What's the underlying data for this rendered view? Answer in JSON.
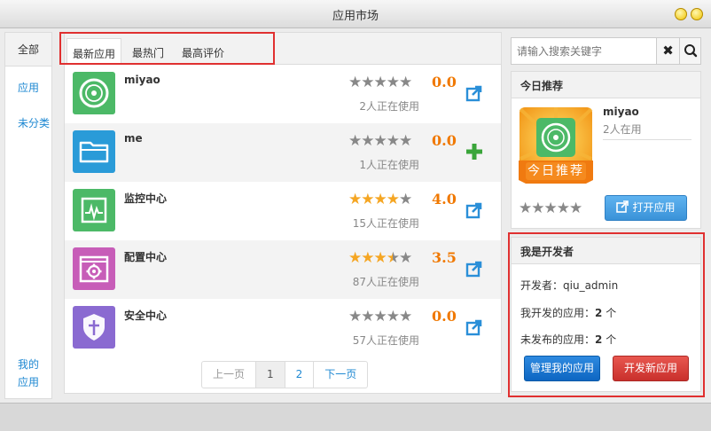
{
  "window": {
    "title": "应用市场"
  },
  "leftnav": {
    "all": "全部",
    "apps": "应用",
    "uncategorized": "未分类",
    "mine": "我的应用"
  },
  "tabs": [
    "最新应用",
    "最热门",
    "最高评价"
  ],
  "apps": [
    {
      "name": "miyao",
      "score": "0.0",
      "rating": 0,
      "users": "2人正在使用",
      "color": "#4cb967",
      "icon": "disc-icon",
      "action": "open"
    },
    {
      "name": "me",
      "score": "0.0",
      "rating": 0,
      "users": "1人正在使用",
      "color": "#2a9bd8",
      "icon": "folder-icon",
      "action": "add"
    },
    {
      "name": "监控中心",
      "score": "4.0",
      "rating": 4,
      "users": "15人正在使用",
      "color": "#4cb967",
      "icon": "monitor-icon",
      "action": "open"
    },
    {
      "name": "配置中心",
      "score": "3.5",
      "rating": 3.5,
      "users": "87人正在使用",
      "color": "#c75db8",
      "icon": "config-icon",
      "action": "open"
    },
    {
      "name": "安全中心",
      "score": "0.0",
      "rating": 0,
      "users": "57人正在使用",
      "color": "#8a6ad1",
      "icon": "shield-icon",
      "action": "open"
    }
  ],
  "pager": {
    "prev": "上一页",
    "pages": [
      "1",
      "2"
    ],
    "next": "下一页"
  },
  "search": {
    "placeholder": "请输入搜索关键字"
  },
  "recommend": {
    "title": "今日推荐",
    "badge": "今日推荐",
    "app_name": "miyao",
    "app_users": "2人在用",
    "open_button": "打开应用"
  },
  "developer": {
    "title": "我是开发者",
    "developer_label": "开发者：",
    "developer_name": "qiu_admin",
    "developed_label": "我开发的应用：",
    "developed_count": "2",
    "unpublished_label": "未发布的应用：",
    "unpublished_count": "2",
    "unit": "个",
    "manage_button": "管理我的应用",
    "new_button": "开发新应用"
  }
}
